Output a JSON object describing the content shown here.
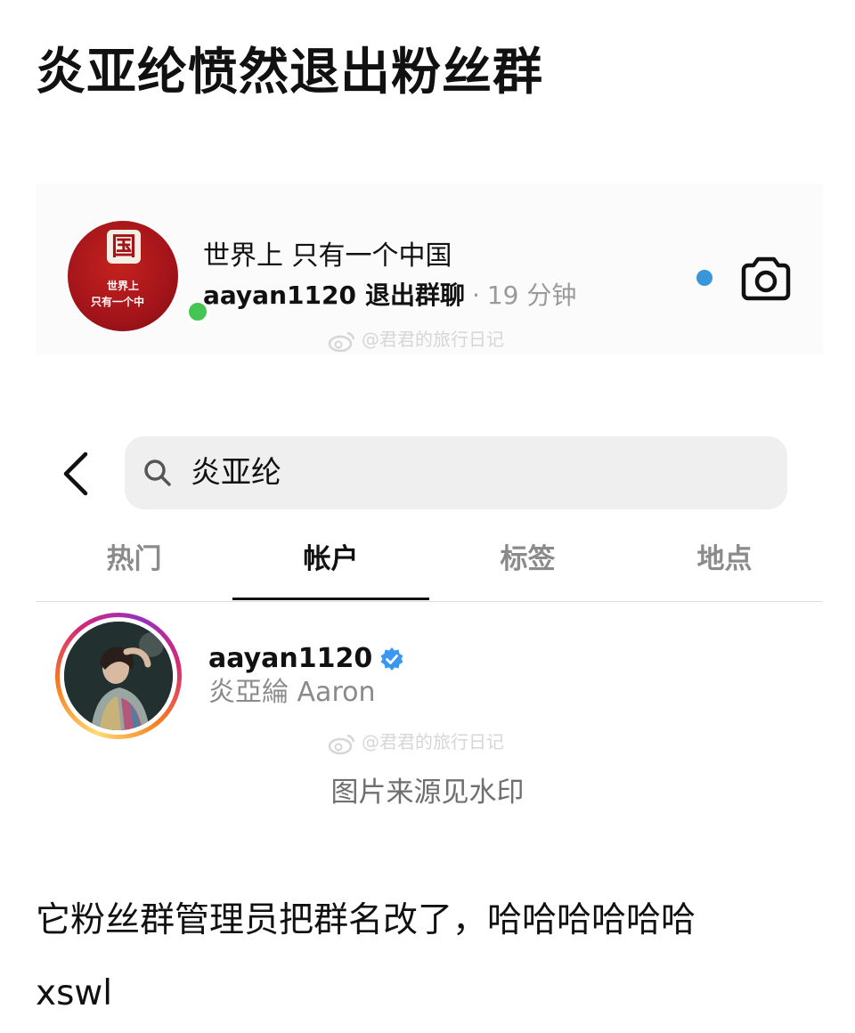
{
  "post": {
    "headline": "炎亚纶愤然退出粉丝群",
    "body": "它粉丝群管理员把群名改了，哈哈哈哈哈哈",
    "body_2": "xswl"
  },
  "chat": {
    "group_name": "世界上 只有一个中国",
    "username": "aayan1120",
    "action": "退出群聊",
    "separator": "·",
    "time": "19 分钟",
    "avatar_emblem": "国",
    "avatar_caption_1": "世界上",
    "avatar_caption_2": "只有一个中",
    "online_color": "#45c654",
    "unread_color": "#3a96db"
  },
  "watermark": "@君君的旅行日记",
  "search": {
    "query": "炎亚纶"
  },
  "tabs": [
    {
      "label": "热门",
      "active": false
    },
    {
      "label": "帐户",
      "active": true
    },
    {
      "label": "标签",
      "active": false
    },
    {
      "label": "地点",
      "active": false
    }
  ],
  "account": {
    "username": "aayan1120",
    "full_name": "炎亞綸 Aaron",
    "verified": true,
    "verified_color": "#3897f0"
  },
  "caption": "图片来源见水印",
  "icons": {
    "back": "chevron-left-icon",
    "search": "magnifier-icon",
    "camera": "camera-icon",
    "verified": "verified-badge-icon",
    "weibo": "weibo-icon"
  }
}
